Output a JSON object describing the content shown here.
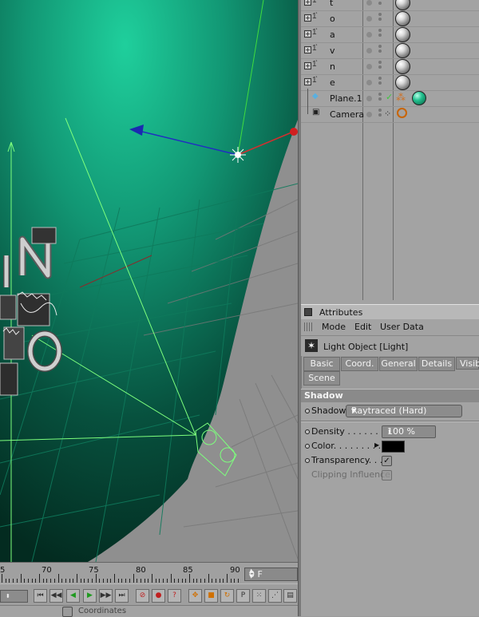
{
  "object_manager": {
    "objects": [
      {
        "name": "t",
        "kind": "text-spline"
      },
      {
        "name": "o",
        "kind": "text-spline"
      },
      {
        "name": "a",
        "kind": "text-spline"
      },
      {
        "name": "v",
        "kind": "text-spline"
      },
      {
        "name": "n",
        "kind": "text-spline"
      },
      {
        "name": "e",
        "kind": "text-spline"
      },
      {
        "name": "Plane.1",
        "kind": "plane"
      },
      {
        "name": "Camera",
        "kind": "camera"
      }
    ]
  },
  "attributes": {
    "title": "Attributes",
    "menu": [
      "Mode",
      "Edit",
      "User Data"
    ],
    "object_label": "Light Object [Light]",
    "tabs": [
      "Basic",
      "Coord.",
      "General",
      "Details",
      "Visib",
      "Scene"
    ],
    "section": "Shadow",
    "shadow_label": "Shadow",
    "shadow_value": "Raytraced (Hard)",
    "density_label": "Density . . . . . . . . .",
    "density_value": "100 %",
    "color_label": "Color. . . . . . . . . . .",
    "color_value": "#000000",
    "transparency_label": "Transparency. . . .",
    "clipping_label": "Clipping Influence"
  },
  "timeline": {
    "tick_labels": [
      "5",
      "70",
      "75",
      "80",
      "85",
      "90"
    ],
    "frame_value": "0 F"
  },
  "statusbar": {
    "coordinates_label": "Coordinates"
  },
  "colors": {
    "viewport_green": "#1aa57f",
    "panel_bg": "#a3a3a3"
  }
}
